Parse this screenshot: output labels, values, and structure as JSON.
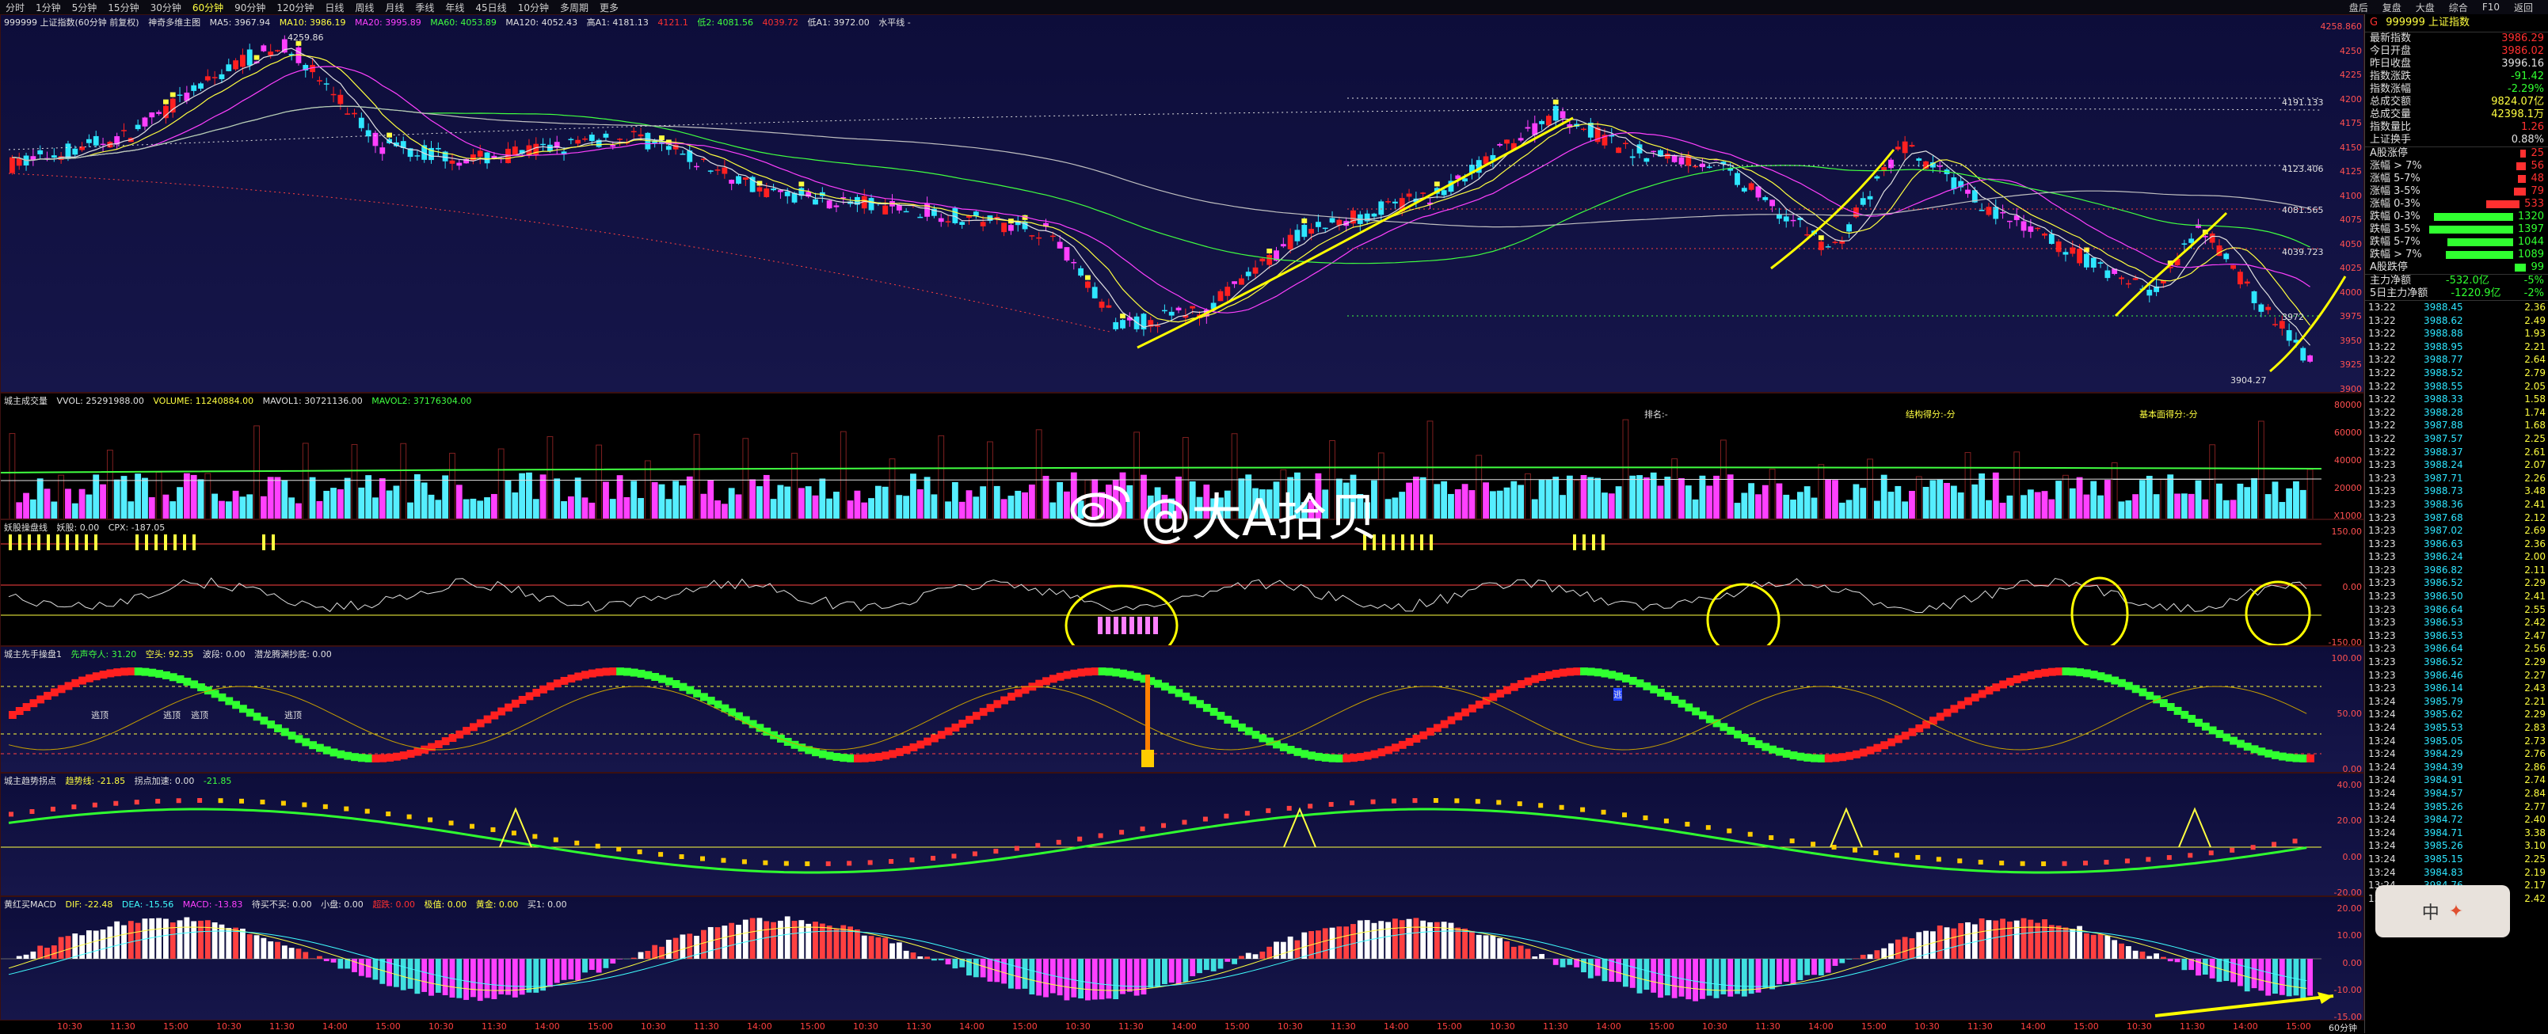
{
  "periods": [
    "分时",
    "1分钟",
    "5分钟",
    "15分钟",
    "30分钟",
    "60分钟",
    "90分钟",
    "120分钟",
    "日线",
    "周线",
    "月线",
    "季线",
    "年线",
    "45日线",
    "10分钟",
    "多周期",
    "更多"
  ],
  "active_period": "60分钟",
  "top_right": [
    "盘后",
    "复盘",
    "大盘",
    "综合",
    "F10",
    "返回"
  ],
  "main": {
    "title": "999999 上证指数(60分钟 前复权)",
    "indicator": "神奇多维主图",
    "ma": [
      "MA5: 3967.94",
      "MA10: 3986.19",
      "MA20: 3995.89",
      "MA60: 4053.89",
      "MA120: 4052.43"
    ],
    "extra": [
      "高A1: 4181.13",
      "4121.1",
      "低2: 4081.56",
      "4039.72",
      "低A1: 3972.00",
      "水平线 -"
    ],
    "high_label": "4259.86",
    "low_label": "3904.27",
    "level_labels": [
      "4191.133",
      "4123.406",
      "4081.565",
      "4039.723",
      "3972"
    ],
    "axis": [
      "4258.860",
      "4250",
      "4225",
      "4200",
      "4175",
      "4150",
      "4125",
      "4100",
      "4075",
      "4050",
      "4025",
      "4000",
      "3975",
      "3950",
      "3925",
      "3900"
    ]
  },
  "vol": {
    "title": "城主成交量",
    "vals": [
      "VVOL: 25291988.00",
      "VOLUME: 11240884.00",
      "MAVOL1: 30721136.00",
      "MAVOL2: 37176304.00"
    ],
    "labels": [
      "排名:-",
      "结构得分:-分",
      "基本面得分:-分"
    ],
    "axis": [
      "80000",
      "60000",
      "40000",
      "20000",
      "X1000"
    ]
  },
  "kdj": {
    "title": "妖股操盘线",
    "vals": [
      "妖股: 0.00",
      "CPX: -187.05"
    ],
    "axis": [
      "150.00",
      "0.00",
      "-150.00"
    ]
  },
  "osc": {
    "title": "城主先手操盘1",
    "vals": [
      "先声夺人: 31.20",
      "空头: 92.35",
      "波段: 0.00",
      "",
      "潜龙腾渊抄底: 0.00"
    ],
    "flags": [
      "逃顶",
      "逃顶",
      "逃顶",
      "逃顶",
      "逃"
    ],
    "axis": [
      "100.00",
      "50.00",
      "0.00"
    ]
  },
  "trend": {
    "title": "城主趋势拐点",
    "vals": [
      "趋势线: -21.85",
      "拐点加速: 0.00",
      "-21.85"
    ],
    "axis": [
      "40.00",
      "20.00",
      "0.00",
      "-20.00"
    ]
  },
  "macd": {
    "title": "黄红买MACD",
    "vals": [
      "DIF: -22.48",
      "DEA: -15.56",
      "MACD: -13.83",
      "待买不买: 0.00",
      "小盘: 0.00",
      "超跌: 0.00",
      "极值: 0.00",
      "黄金: 0.00",
      "",
      "买1: 0.00"
    ],
    "axis": [
      "20.00",
      "10.00",
      "0.00",
      "-10.00",
      "-15.00"
    ]
  },
  "dates": [
    "10:30",
    "11:30",
    "15:00",
    "10:30",
    "11:30",
    "14:00",
    "15:00",
    "10:30",
    "11:30",
    "14:00",
    "15:00",
    "10:30",
    "11:30",
    "14:00",
    "15:00",
    "10:30",
    "11:30",
    "14:00",
    "15:00",
    "10:30",
    "11:30",
    "14:00",
    "15:00",
    "10:30",
    "11:30",
    "14:00",
    "15:00",
    "10:30",
    "11:30",
    "14:00",
    "15:00",
    "10:30",
    "11:30",
    "14:00",
    "15:00",
    "10:30",
    "11:30",
    "14:00",
    "15:00",
    "10:30",
    "11:30",
    "14:00",
    "15:00"
  ],
  "date_end": "60分钟",
  "watermark": "@大A拾贝",
  "badge": "中",
  "right": {
    "title": "999999 上证指数",
    "prefix": "G",
    "stats": [
      {
        "k": "最新指数",
        "v": "3986.29",
        "c": "#ff3030"
      },
      {
        "k": "今日开盘",
        "v": "3986.02",
        "c": "#ff3030"
      },
      {
        "k": "昨日收盘",
        "v": "3996.16",
        "c": "#e0e0e0"
      },
      {
        "k": "指数涨跌",
        "v": "-91.42",
        "c": "#30ff30"
      },
      {
        "k": "指数涨幅",
        "v": "-2.29%",
        "c": "#30ff30"
      },
      {
        "k": "总成交额",
        "v": "9824.07亿",
        "c": "#ffff40"
      },
      {
        "k": "总成交量",
        "v": "42398.1万",
        "c": "#ffff40"
      },
      {
        "k": "指数量比",
        "v": "1.26",
        "c": "#ff3030"
      },
      {
        "k": "上证换手",
        "v": "0.88%",
        "c": "#e0e0e0"
      }
    ],
    "breadth": [
      {
        "k": "A股涨停",
        "v": "25",
        "c": "#ff3030",
        "w": 0.05
      },
      {
        "k": "涨幅 > 7%",
        "v": "56",
        "c": "#ff3030",
        "w": 0.1
      },
      {
        "k": "涨幅 5-7%",
        "v": "48",
        "c": "#ff3030",
        "w": 0.08
      },
      {
        "k": "涨幅 3-5%",
        "v": "79",
        "c": "#ff3030",
        "w": 0.12
      },
      {
        "k": "涨幅 0-3%",
        "v": "533",
        "c": "#ff3030",
        "w": 0.35
      },
      {
        "k": "跌幅 0-3%",
        "v": "1320",
        "c": "#30ff30",
        "w": 0.9
      },
      {
        "k": "跌幅 3-5%",
        "v": "1397",
        "c": "#30ff30",
        "w": 0.95
      },
      {
        "k": "跌幅 5-7%",
        "v": "1044",
        "c": "#30ff30",
        "w": 0.75
      },
      {
        "k": "跌幅 > 7%",
        "v": "1089",
        "c": "#30ff30",
        "w": 0.78
      },
      {
        "k": "A股跌停",
        "v": "99",
        "c": "#30ff30",
        "w": 0.1
      }
    ],
    "flows": [
      {
        "k": "主力净额",
        "v": "-532.0亿",
        "p": "-5%"
      },
      {
        "k": "5日主力净额",
        "v": "-1220.9亿",
        "p": "-2%"
      }
    ],
    "ticks": [
      [
        "13:22",
        "3988.45",
        "2.36"
      ],
      [
        "13:22",
        "3988.62",
        "2.49"
      ],
      [
        "13:22",
        "3988.88",
        "1.93"
      ],
      [
        "13:22",
        "3988.95",
        "2.21"
      ],
      [
        "13:22",
        "3988.77",
        "2.64"
      ],
      [
        "13:22",
        "3988.52",
        "2.79"
      ],
      [
        "13:22",
        "3988.55",
        "2.05"
      ],
      [
        "13:22",
        "3988.33",
        "1.58"
      ],
      [
        "13:22",
        "3988.28",
        "1.74"
      ],
      [
        "13:22",
        "3987.88",
        "1.68"
      ],
      [
        "13:22",
        "3987.57",
        "2.25"
      ],
      [
        "13:22",
        "3988.37",
        "2.61"
      ],
      [
        "13:23",
        "3988.24",
        "2.07"
      ],
      [
        "13:23",
        "3987.71",
        "2.26"
      ],
      [
        "13:23",
        "3988.73",
        "3.48"
      ],
      [
        "13:23",
        "3988.36",
        "2.41"
      ],
      [
        "13:23",
        "3987.68",
        "2.12"
      ],
      [
        "13:23",
        "3987.02",
        "2.69"
      ],
      [
        "13:23",
        "3986.63",
        "2.36"
      ],
      [
        "13:23",
        "3986.24",
        "2.00"
      ],
      [
        "13:23",
        "3986.82",
        "2.11"
      ],
      [
        "13:23",
        "3986.52",
        "2.29"
      ],
      [
        "13:23",
        "3986.50",
        "2.41"
      ],
      [
        "13:23",
        "3986.64",
        "2.55"
      ],
      [
        "13:23",
        "3986.53",
        "2.42"
      ],
      [
        "13:23",
        "3986.53",
        "2.47"
      ],
      [
        "13:23",
        "3986.64",
        "2.56"
      ],
      [
        "13:23",
        "3986.52",
        "2.29"
      ],
      [
        "13:23",
        "3986.46",
        "2.27"
      ],
      [
        "13:23",
        "3986.14",
        "2.43"
      ],
      [
        "13:24",
        "3985.79",
        "2.21"
      ],
      [
        "13:24",
        "3985.62",
        "2.29"
      ],
      [
        "13:24",
        "3985.53",
        "2.83"
      ],
      [
        "13:24",
        "3985.05",
        "2.73"
      ],
      [
        "13:24",
        "3984.29",
        "2.76"
      ],
      [
        "13:24",
        "3984.39",
        "2.86"
      ],
      [
        "13:24",
        "3984.91",
        "2.74"
      ],
      [
        "13:24",
        "3984.57",
        "2.84"
      ],
      [
        "13:24",
        "3985.26",
        "2.77"
      ],
      [
        "13:24",
        "3984.72",
        "2.40"
      ],
      [
        "13:24",
        "3984.71",
        "3.38"
      ],
      [
        "13:24",
        "3985.26",
        "3.10"
      ],
      [
        "13:24",
        "3985.15",
        "2.25"
      ],
      [
        "13:24",
        "3984.83",
        "2.19"
      ],
      [
        "13:24",
        "3984.76",
        "2.17"
      ],
      [
        "13:24",
        "3984.56",
        "2.42"
      ]
    ]
  }
}
